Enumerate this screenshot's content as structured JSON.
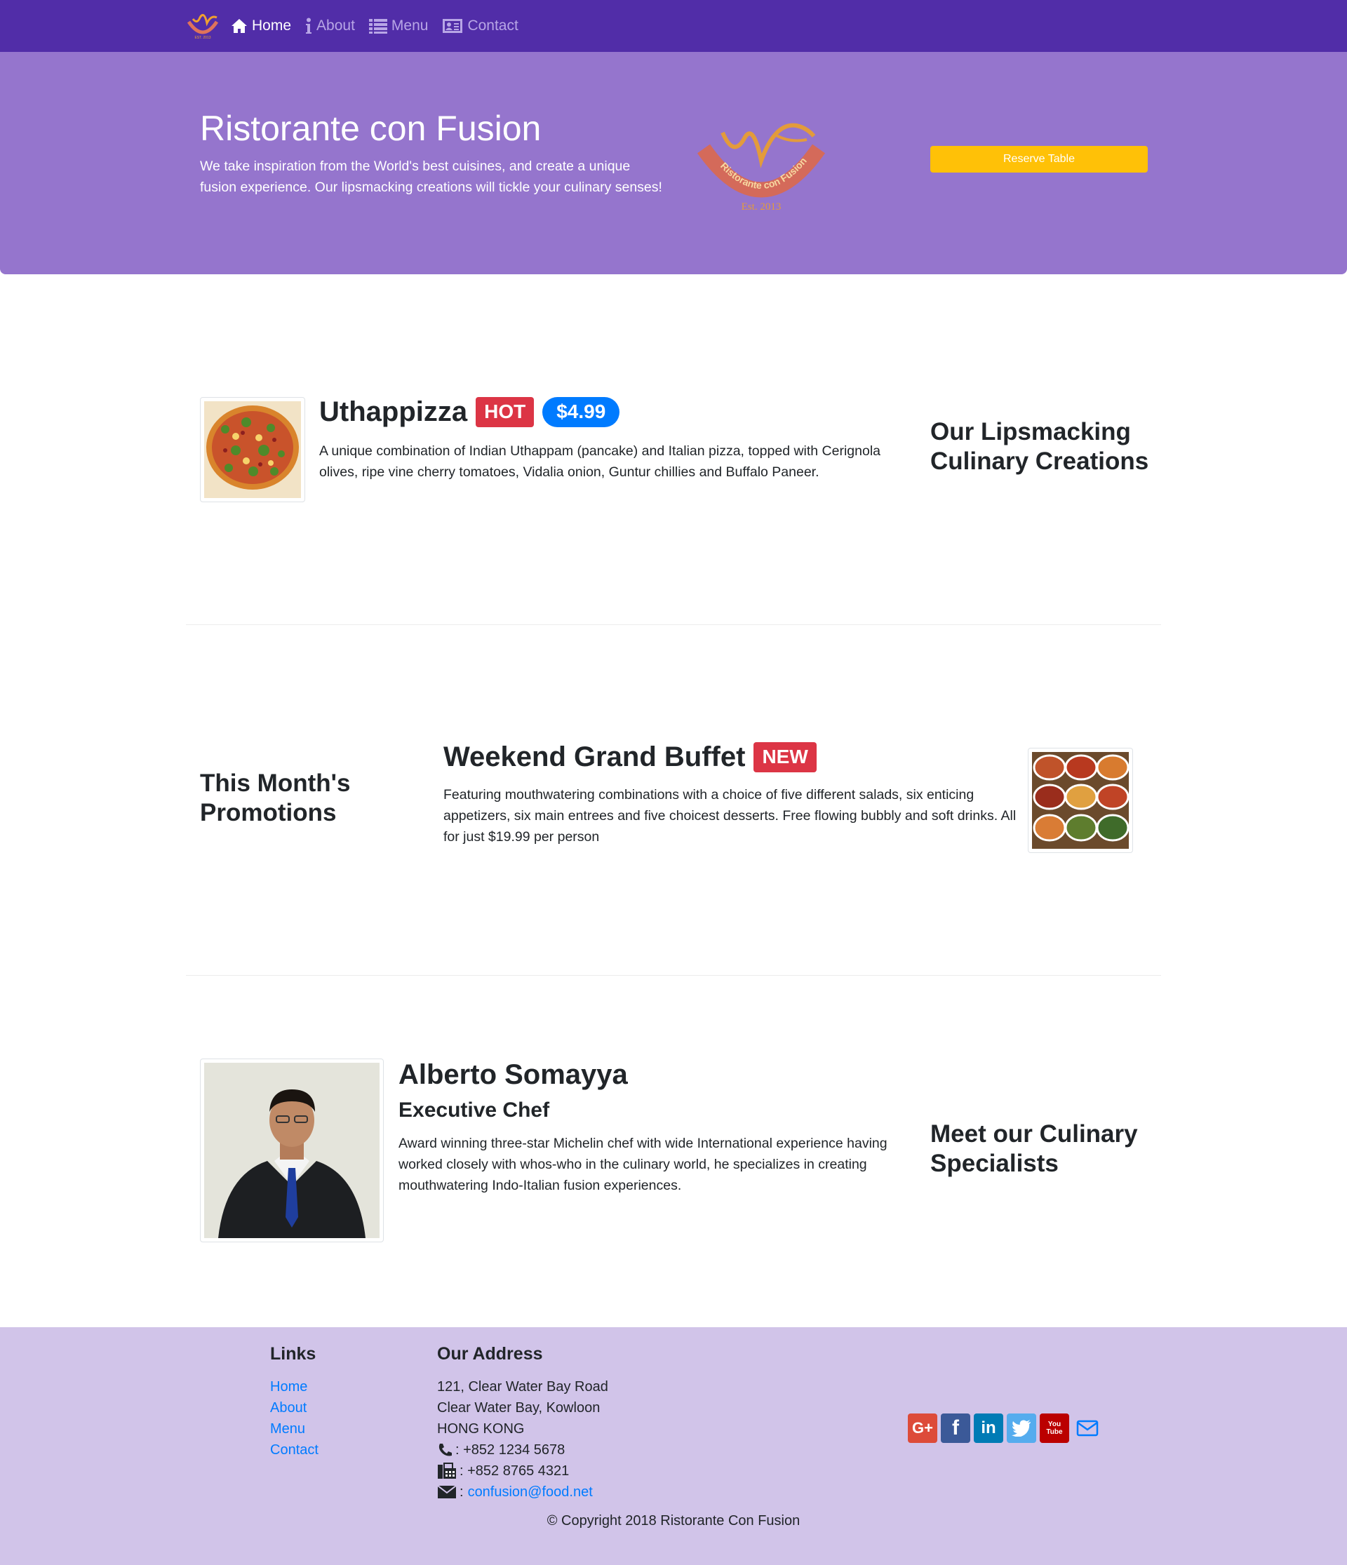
{
  "nav": {
    "brand_alt": "Ristorante con Fusion logo",
    "items": [
      {
        "label": "Home",
        "icon": "home-icon",
        "active": true
      },
      {
        "label": "About",
        "icon": "info-icon",
        "active": false
      },
      {
        "label": "Menu",
        "icon": "list-icon",
        "active": false
      },
      {
        "label": "Contact",
        "icon": "address-card-icon",
        "active": false
      }
    ]
  },
  "jumbotron": {
    "title": "Ristorante con Fusion",
    "text": "We take inspiration from the World's best cuisines, and create a unique fusion experience. Our lipsmacking creations will tickle your culinary senses!",
    "logo_text": "Ristorante con Fusion",
    "logo_est": "Est. 2013",
    "reserve_label": "Reserve Table"
  },
  "dish": {
    "title": "Uthappizza",
    "badge": "HOT",
    "price": "$4.99",
    "description": "A unique combination of Indian Uthappam (pancake) and Italian pizza, topped with Cerignola olives, ripe vine cherry tomatoes, Vidalia onion, Guntur chillies and Buffalo Paneer.",
    "side_heading": "Our Lipsmacking Culinary Creations"
  },
  "promotion": {
    "side_heading": "This Month's Promotions",
    "title": "Weekend Grand Buffet",
    "badge": "NEW",
    "description": "Featuring mouthwatering combinations with a choice of five different salads, six enticing appetizers, six main entrees and five choicest desserts. Free flowing bubbly and soft drinks. All for just $19.99 per person"
  },
  "leader": {
    "name": "Alberto Somayya",
    "designation": "Executive Chef",
    "description": "Award winning three-star Michelin chef with wide International experience having worked closely with whos-who in the culinary world, he specializes in creating mouthwatering Indo-Italian fusion experiences.",
    "side_heading": "Meet our Culinary Specialists"
  },
  "footer": {
    "links_heading": "Links",
    "links": [
      "Home",
      "About",
      "Menu",
      "Contact"
    ],
    "address_heading": "Our Address",
    "address_lines": [
      "121, Clear Water Bay Road",
      "Clear Water Bay, Kowloon",
      "HONG KONG"
    ],
    "phone": ": +852 1234 5678",
    "fax": ": +852 8765 4321",
    "email_prefix": ":",
    "email": "confusion@food.net",
    "social": [
      {
        "name": "google-plus-icon",
        "label": "G+",
        "color": "#dd4b39"
      },
      {
        "name": "facebook-icon",
        "label": "f",
        "color": "#3b5998"
      },
      {
        "name": "linkedin-icon",
        "label": "in",
        "color": "#007bb5"
      },
      {
        "name": "twitter-icon",
        "label": "t",
        "color": "#55acee"
      },
      {
        "name": "youtube-icon",
        "label": "You Tube",
        "color": "#bb0000"
      }
    ],
    "copyright": "© Copyright 2018 Ristorante Con Fusion"
  },
  "colors": {
    "navbar": "#512da8",
    "jumbotron": "#9575cd",
    "footer": "#d1c4e9",
    "reserve": "#ffc107",
    "hot": "#dc3545",
    "price": "#007bff"
  }
}
